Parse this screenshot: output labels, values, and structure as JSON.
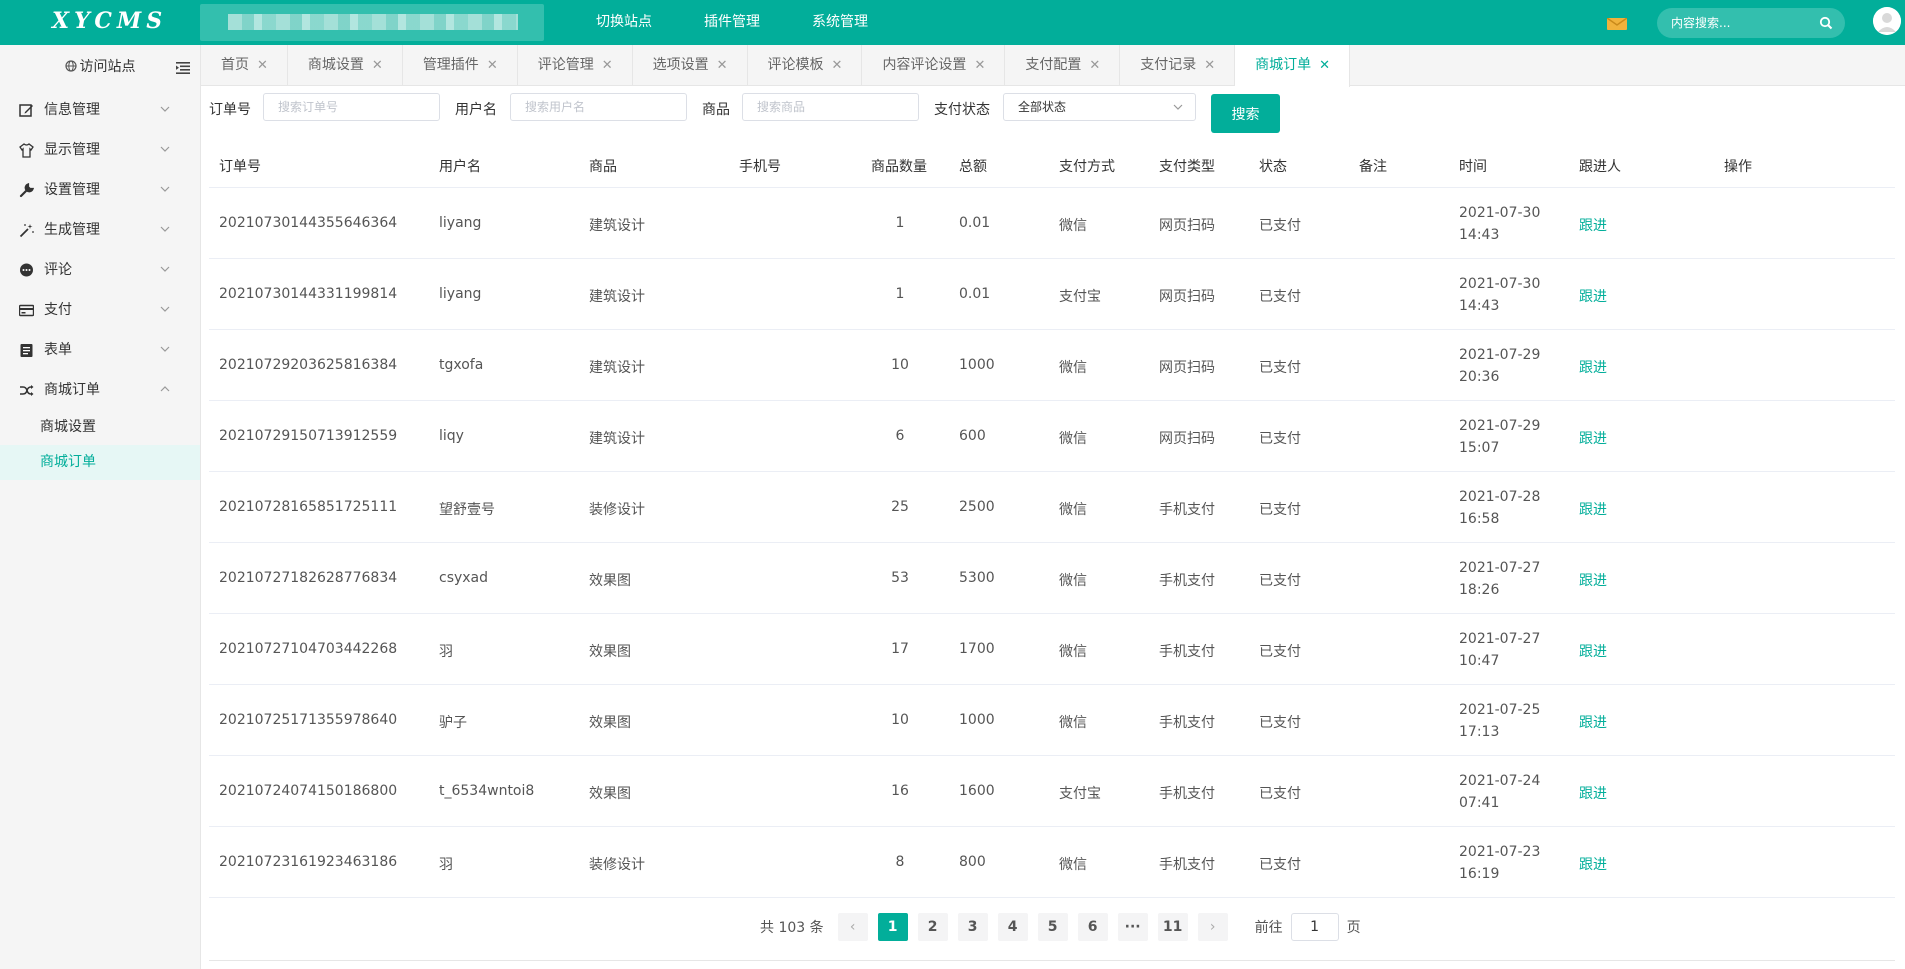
{
  "app": {
    "logo": "XYCMS"
  },
  "topnav": [
    "切换站点",
    "插件管理",
    "系统管理"
  ],
  "search": {
    "placeholder": "内容搜索..."
  },
  "sidebar": {
    "visit": "访问站点",
    "items": [
      {
        "label": "信息管理",
        "icon": "edit-icon"
      },
      {
        "label": "显示管理",
        "icon": "shirt-icon"
      },
      {
        "label": "设置管理",
        "icon": "wrench-icon"
      },
      {
        "label": "生成管理",
        "icon": "magic-wand-icon"
      },
      {
        "label": "评论",
        "icon": "comment-icon"
      },
      {
        "label": "支付",
        "icon": "credit-card-icon"
      },
      {
        "label": "表单",
        "icon": "form-icon"
      },
      {
        "label": "商城订单",
        "icon": "shuffle-icon"
      }
    ],
    "sub_items": [
      "商城设置",
      "商城订单"
    ]
  },
  "tabs": [
    "首页",
    "商城设置",
    "管理插件",
    "评论管理",
    "选项设置",
    "评论模板",
    "内容评论设置",
    "支付配置",
    "支付记录",
    "商城订单"
  ],
  "filters": {
    "order_label": "订单号",
    "order_placeholder": "搜索订单号",
    "user_label": "用户名",
    "user_placeholder": "搜索用户名",
    "goods_label": "商品",
    "goods_placeholder": "搜索商品",
    "status_label": "支付状态",
    "status_value": "全部状态",
    "search_btn": "搜索"
  },
  "table": {
    "headers": [
      "订单号",
      "用户名",
      "商品",
      "手机号",
      "商品数量",
      "总额",
      "支付方式",
      "支付类型",
      "状态",
      "备注",
      "时间",
      "跟进人",
      "操作"
    ],
    "rows": [
      [
        "20210730144355646364",
        "liyang",
        "建筑设计",
        "",
        "1",
        "0.01",
        "微信",
        "网页扫码",
        "已支付",
        "",
        "2021-07-30 14:43",
        "跟进"
      ],
      [
        "20210730144331199814",
        "liyang",
        "建筑设计",
        "",
        "1",
        "0.01",
        "支付宝",
        "网页扫码",
        "已支付",
        "",
        "2021-07-30 14:43",
        "跟进"
      ],
      [
        "20210729203625816384",
        "tgxofa",
        "建筑设计",
        "",
        "10",
        "1000",
        "微信",
        "网页扫码",
        "已支付",
        "",
        "2021-07-29 20:36",
        "跟进"
      ],
      [
        "20210729150713912559",
        "liqy",
        "建筑设计",
        "",
        "6",
        "600",
        "微信",
        "网页扫码",
        "已支付",
        "",
        "2021-07-29 15:07",
        "跟进"
      ],
      [
        "20210728165851725111",
        "望舒壹号",
        "装修设计",
        "",
        "25",
        "2500",
        "微信",
        "手机支付",
        "已支付",
        "",
        "2021-07-28 16:58",
        "跟进"
      ],
      [
        "20210727182628776834",
        "csyxad",
        "效果图",
        "",
        "53",
        "5300",
        "微信",
        "手机支付",
        "已支付",
        "",
        "2021-07-27 18:26",
        "跟进"
      ],
      [
        "20210727104703442268",
        "羽",
        "效果图",
        "",
        "17",
        "1700",
        "微信",
        "手机支付",
        "已支付",
        "",
        "2021-07-27 10:47",
        "跟进"
      ],
      [
        "20210725171355978640",
        "驴子",
        "效果图",
        "",
        "10",
        "1000",
        "微信",
        "手机支付",
        "已支付",
        "",
        "2021-07-25 17:13",
        "跟进"
      ],
      [
        "20210724074150186800",
        "t_6534wntoi8",
        "效果图",
        "",
        "16",
        "1600",
        "支付宝",
        "手机支付",
        "已支付",
        "",
        "2021-07-24 07:41",
        "跟进"
      ],
      [
        "20210723161923463186",
        "羽",
        "装修设计",
        "",
        "8",
        "800",
        "微信",
        "手机支付",
        "已支付",
        "",
        "2021-07-23 16:19",
        "跟进"
      ]
    ]
  },
  "pagination": {
    "total": "共 103 条",
    "pages": [
      "1",
      "2",
      "3",
      "4",
      "5",
      "6",
      "···",
      "11"
    ],
    "prev": "‹",
    "next": "›",
    "goto_label": "前往",
    "goto_value": "1",
    "goto_suffix": "页"
  },
  "colors": {
    "accent": "#02ae9a"
  }
}
